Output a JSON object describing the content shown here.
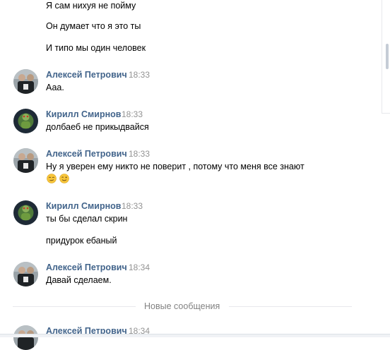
{
  "messages": {
    "top_group": {
      "lines": [
        "Я сам нихуя не пойму",
        "Он думает что я это ты",
        "И типо мы один человек"
      ]
    },
    "m1": {
      "author": "Алексей Петрович",
      "time": "18:33",
      "lines": [
        "Ааа."
      ]
    },
    "m2": {
      "author": "Кирилл Смирнов",
      "time": "18:33",
      "lines": [
        "долбаеб не прикыдвайся"
      ]
    },
    "m3": {
      "author": "Алексей Петрович",
      "time": "18:33",
      "lines": [
        "Ну я уверен ему никто не поверит , потому что меня все знают"
      ],
      "emojis": [
        "smirk-emoji",
        "wink-emoji"
      ]
    },
    "m4": {
      "author": "Кирилл Смирнов",
      "time": "18:33",
      "lines": [
        "ты бы сделал скрин",
        "придурок ебаный"
      ]
    },
    "m5": {
      "author": "Алексей Петрович",
      "time": "18:34",
      "lines": [
        "Давай сделаем."
      ]
    },
    "m6": {
      "author": "Алексей Петрович",
      "time": "18:34"
    }
  },
  "divider": {
    "label": "Новые сообщения"
  },
  "colors": {
    "author": "#42648b",
    "time": "#939393",
    "divider": "#e7e8ec"
  }
}
